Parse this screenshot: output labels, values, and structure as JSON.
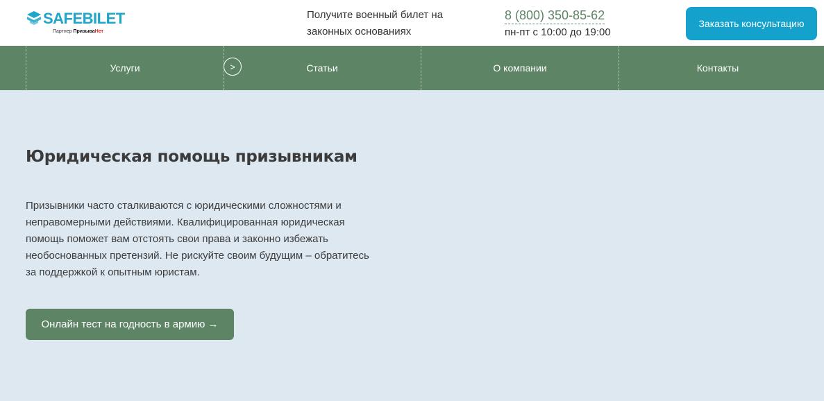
{
  "header": {
    "logo": {
      "name": "SAFEBILET",
      "partner_prefix": "Партнер",
      "partner_brand_1": "Призыва",
      "partner_brand_2": "Нет"
    },
    "tagline_line1": "Получите военный билет на",
    "tagline_line2": "законных основаниях",
    "phone": "8 (800) 350-85-62",
    "hours": "пн-пт с 10:00 до 19:00",
    "cta_label": "Заказать консультацию"
  },
  "nav": {
    "items": [
      {
        "label": "Услуги"
      },
      {
        "label": "Статьи"
      },
      {
        "label": "О компании"
      },
      {
        "label": "Контакты"
      }
    ],
    "expand_glyph": ">"
  },
  "hero": {
    "title": "Юридическая помощь призывникам",
    "text": "Призывники часто сталкиваются с юридическими сложностями и неправомерными действиями. Квалифицированная юридическая помощь поможет вам отстоять свои права и законно избежать необоснованных претензий. Не рискуйте своим будущим – обратитесь за поддержкой к опытным юристам.",
    "button_label": "Онлайн тест на годность в армию →"
  },
  "colors": {
    "brand_blue": "#14a2cc",
    "brand_green": "#5e8466",
    "page_bg": "#dde8f0"
  }
}
